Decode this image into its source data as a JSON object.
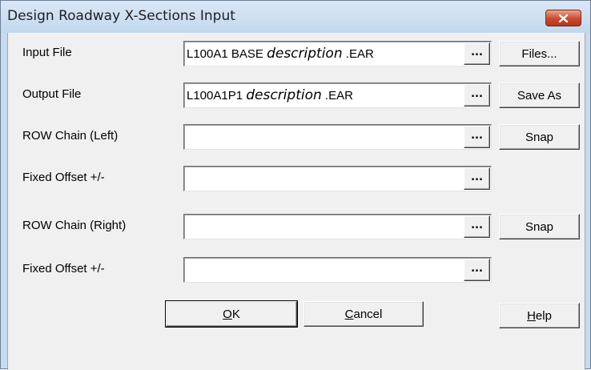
{
  "window": {
    "title": "Design Roadway X-Sections Input",
    "close_icon": "close-icon"
  },
  "rows": [
    {
      "label": "Input File",
      "value_prefix": "L100A1 BASE ",
      "value_italic": "description",
      "value_suffix": " .EAR",
      "browse": "...",
      "button": "Files..."
    },
    {
      "label": "Output File",
      "value_prefix": "L100A1P1 ",
      "value_italic": "description",
      "value_suffix": " .EAR",
      "browse": "...",
      "button": "Save As"
    },
    {
      "label": "ROW Chain (Left)",
      "value_prefix": "",
      "value_italic": "",
      "value_suffix": "",
      "browse": "...",
      "button": "Snap"
    },
    {
      "label": "Fixed Offset +/-",
      "value_prefix": "",
      "value_italic": "",
      "value_suffix": "",
      "browse": "..."
    },
    {
      "label": "ROW Chain (Right)",
      "value_prefix": "",
      "value_italic": "",
      "value_suffix": "",
      "browse": "...",
      "button": "Snap"
    },
    {
      "label": "Fixed Offset +/-",
      "value_prefix": "",
      "value_italic": "",
      "value_suffix": "",
      "browse": "..."
    }
  ],
  "footer": {
    "ok": {
      "mnemonic": "O",
      "rest": "K"
    },
    "cancel": {
      "mnemonic": "C",
      "rest": "ancel"
    },
    "help": {
      "mnemonic": "H",
      "rest": "elp"
    }
  },
  "colors": {
    "titlebar": "#c7daee",
    "client": "#f0f0f0",
    "close_button": "#c94a2e"
  }
}
